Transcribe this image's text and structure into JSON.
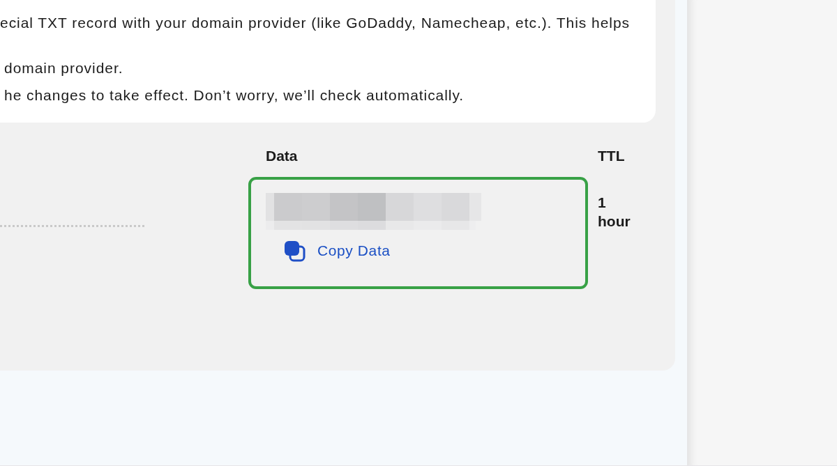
{
  "instructions": {
    "lines": [
      "ecial TXT record with your domain provider (like GoDaddy, Namecheap, etc.). This helps",
      "domain provider.",
      "he changes to take effect. Don’t worry, we’ll check automatically."
    ]
  },
  "records": {
    "columns": [
      {
        "label": "Data"
      },
      {
        "label": "TTL"
      }
    ],
    "rows": [
      {
        "highlighted": true,
        "copy_label": "Copy Data",
        "ttl": "1 hour"
      }
    ]
  }
}
